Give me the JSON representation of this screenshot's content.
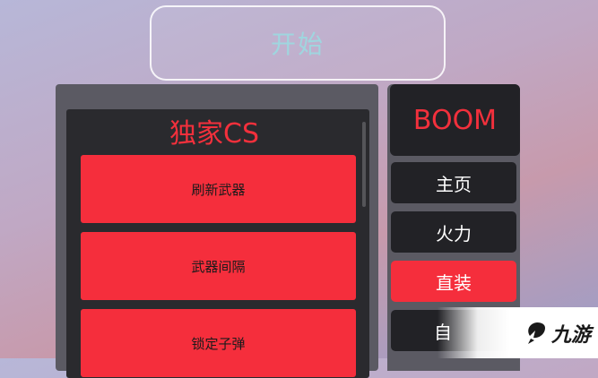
{
  "start_button": {
    "label": "开始"
  },
  "main_panel": {
    "title": "独家CS",
    "items": [
      {
        "label": "刷新武器"
      },
      {
        "label": "武器间隔"
      },
      {
        "label": "锁定子弹"
      }
    ]
  },
  "side_panel": {
    "header": "BOOM",
    "nav": [
      {
        "label": "主页",
        "active": false
      },
      {
        "label": "火力",
        "active": false
      },
      {
        "label": "直装",
        "active": true
      },
      {
        "label": "自",
        "active": false
      }
    ]
  },
  "watermark": {
    "text": "九游",
    "logo_icon": "jiuyou-logo-icon"
  },
  "colors": {
    "accent_red": "#f52e3c",
    "dark_panel": "#222226",
    "start_text": "#9fd6df"
  }
}
